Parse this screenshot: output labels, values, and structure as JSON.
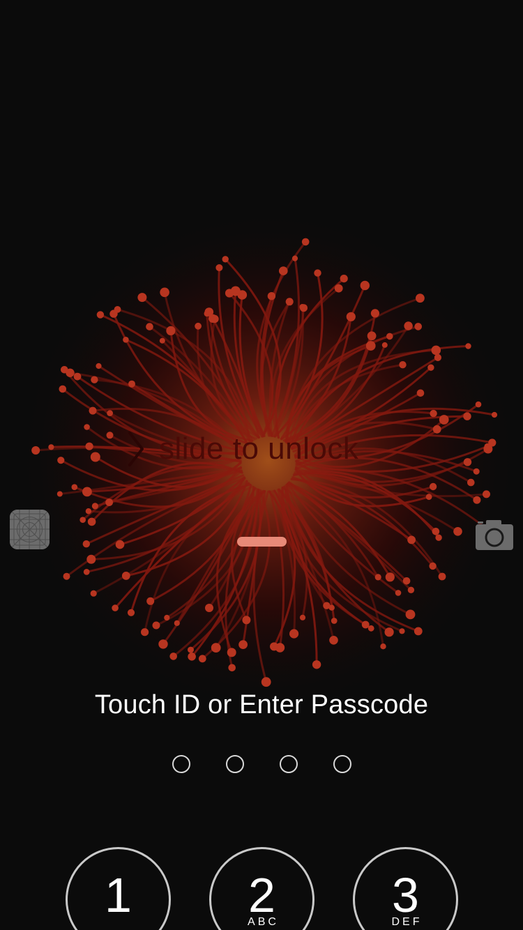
{
  "lock_screen": {
    "slide_text": "slide to unlock",
    "passcode_prompt": "Touch ID or Enter Passcode",
    "passcode_dots_count": 4,
    "keypad": [
      {
        "number": "1",
        "letters": ""
      },
      {
        "number": "2",
        "letters": "ABC"
      },
      {
        "number": "3",
        "letters": "DEF"
      }
    ],
    "icons": {
      "slide": "chevron-right-icon",
      "control_center": "control-center-grabber-icon",
      "camera": "camera-icon"
    }
  },
  "colors": {
    "background": "#0b0b0b",
    "flower_petal": "#8b1a10",
    "flower_tip": "#c23a22",
    "grabber": "#e88a78",
    "text": "#ffffff"
  }
}
